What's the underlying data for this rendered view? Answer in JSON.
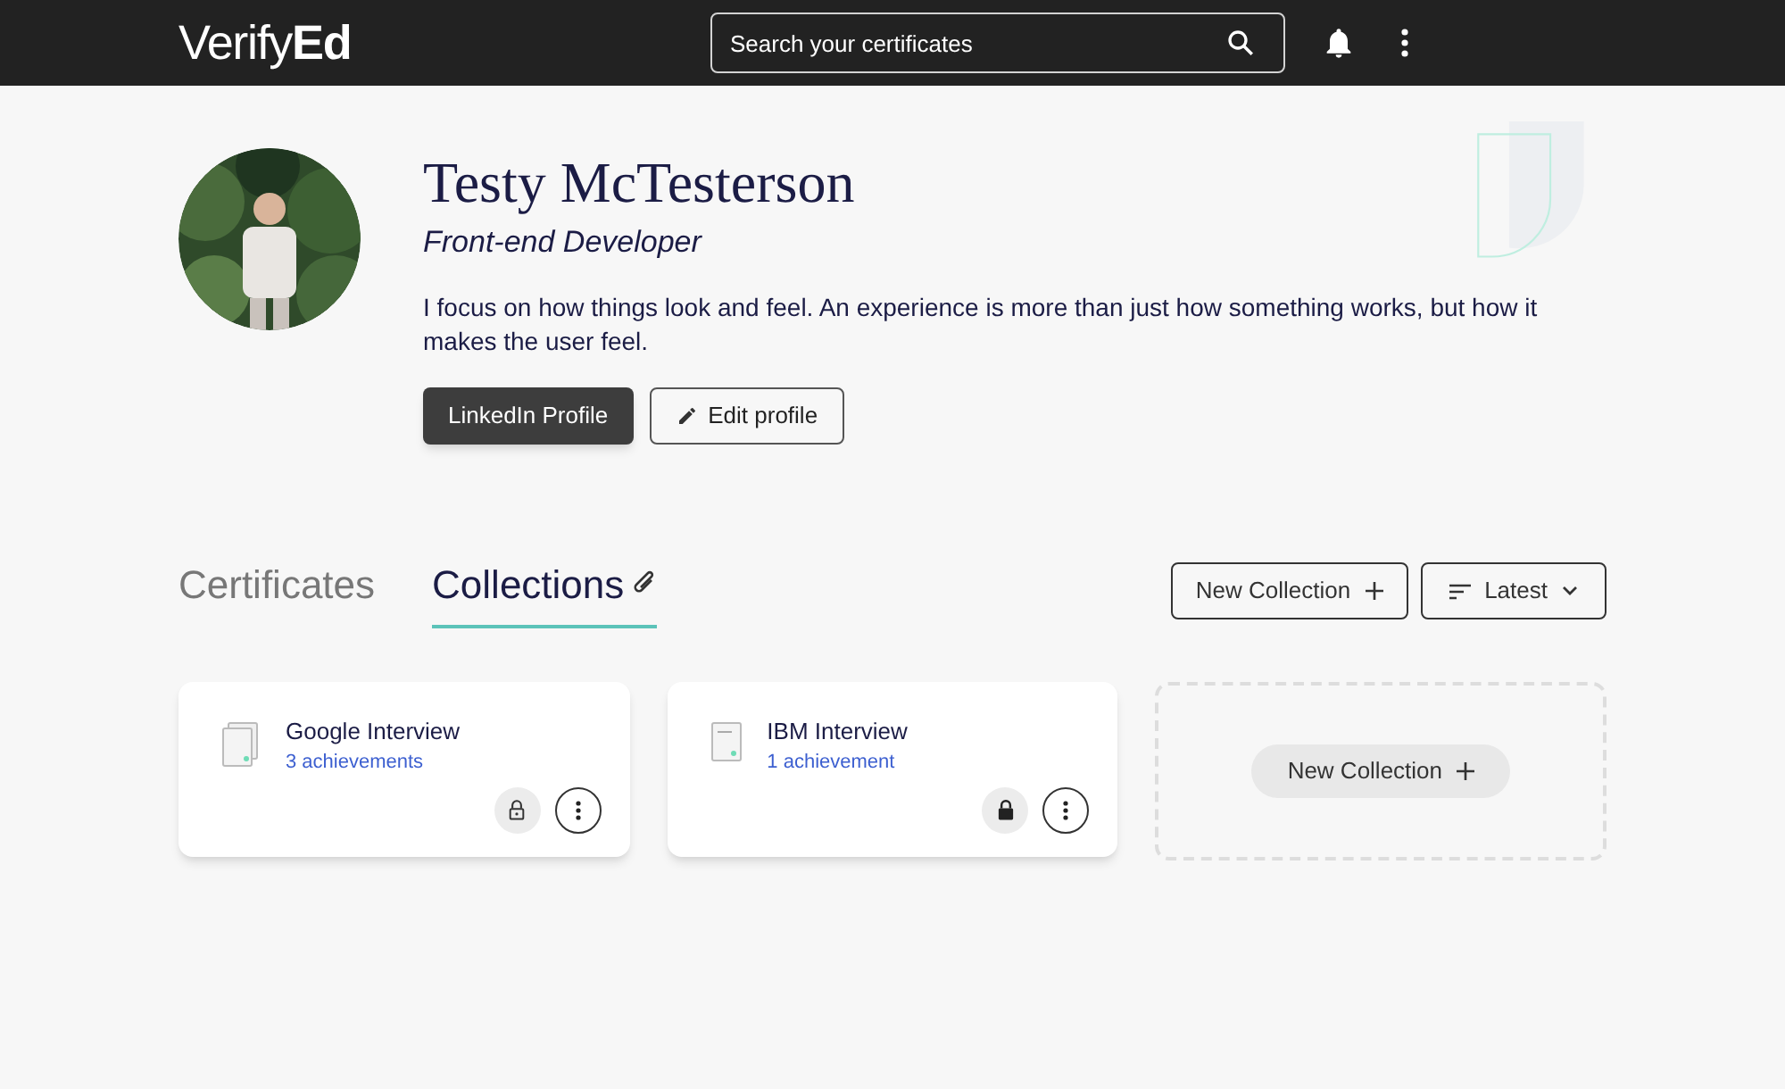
{
  "header": {
    "logo_light": "Verify",
    "logo_bold": "Ed",
    "search": {
      "placeholder": "Search your certificates"
    }
  },
  "profile": {
    "name": "Testy McTesterson",
    "role": "Front-end Developer",
    "bio": "I focus on how things look and feel. An experience is more than just how something works, but how it makes the user feel.",
    "buttons": [
      {
        "label": "LinkedIn Profile",
        "kind": "primary"
      },
      {
        "label": "Edit profile",
        "kind": "edit"
      }
    ]
  },
  "tabs": [
    {
      "label": "Certificates",
      "selected": false
    },
    {
      "label": "Collections",
      "selected": true
    }
  ],
  "actions": {
    "new_collection": "New Collection",
    "sort": "Latest"
  },
  "collections": [
    {
      "title": "Google Interview",
      "count": "3 achievements",
      "kind": "stack",
      "locked": false
    },
    {
      "title": "IBM Interview",
      "count": "1 achievement",
      "kind": "single",
      "locked": true
    }
  ],
  "new_card": {
    "label": "New Collection"
  }
}
